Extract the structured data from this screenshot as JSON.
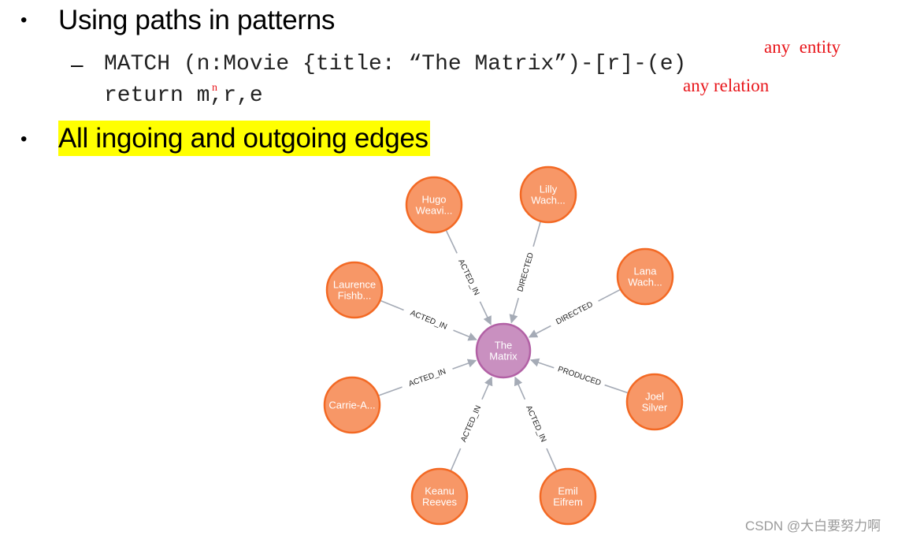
{
  "slide": {
    "bullets": [
      {
        "text": "Using paths in patterns"
      },
      {
        "text": "All ingoing and outgoing edges",
        "highlight": "#ffff00"
      }
    ],
    "sub_bullet_dash": "–",
    "code_line1": "MATCH (n:Movie {title: “The Matrix”)-[r]-(e)",
    "code_line2": "return m,r,e",
    "annotations": {
      "entity": "any  entity",
      "relation": "any relation",
      "correction": "n"
    },
    "bullet_glyph": "•"
  },
  "graph": {
    "colors": {
      "center_fill": "#c990c0",
      "center_stroke": "#b261a5",
      "node_fill": "#f79767",
      "node_stroke": "#f36924",
      "edge": "#a5abb6"
    },
    "center": {
      "id": "matrix",
      "lines": [
        "The",
        "Matrix"
      ]
    },
    "nodes": [
      {
        "id": "hugo",
        "lines": [
          "Hugo",
          "Weavi..."
        ],
        "rel": "ACTED_IN"
      },
      {
        "id": "lilly",
        "lines": [
          "Lilly",
          "Wach..."
        ],
        "rel": "DIRECTED"
      },
      {
        "id": "lana",
        "lines": [
          "Lana",
          "Wach..."
        ],
        "rel": "DIRECTED"
      },
      {
        "id": "joel",
        "lines": [
          "Joel",
          "Silver"
        ],
        "rel": "PRODUCED"
      },
      {
        "id": "emil",
        "lines": [
          "Emil",
          "Eifrem"
        ],
        "rel": "ACTED_IN"
      },
      {
        "id": "keanu",
        "lines": [
          "Keanu",
          "Reeves"
        ],
        "rel": "ACTED_IN"
      },
      {
        "id": "carrie",
        "lines": [
          "Carrie-A..."
        ],
        "rel": "ACTED_IN"
      },
      {
        "id": "laurence",
        "lines": [
          "Laurence",
          "Fishb..."
        ],
        "rel": "ACTED_IN"
      }
    ]
  },
  "watermark": "CSDN @大白要努力啊"
}
